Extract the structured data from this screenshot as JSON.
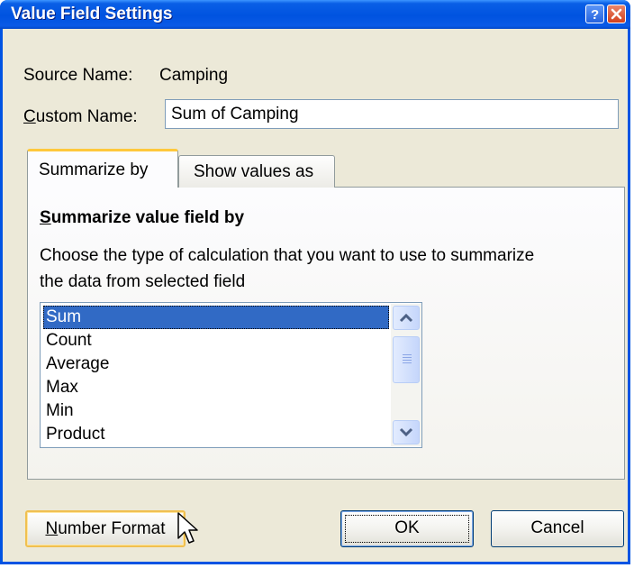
{
  "dialog": {
    "title": "Value Field Settings",
    "source_name_label": "Source Name:",
    "source_name_value": "Camping",
    "custom_name_label": "Custom Name:",
    "custom_name_value": "Sum of Camping"
  },
  "tabs": [
    {
      "label": "Summarize by",
      "active": true
    },
    {
      "label": "Show values as",
      "active": false
    }
  ],
  "panel": {
    "heading": "Summarize value field by",
    "desc_line1": "Choose the type of calculation that you want to use to summarize",
    "desc_line2": "the data from selected field"
  },
  "listbox": {
    "items": [
      "Sum",
      "Count",
      "Average",
      "Max",
      "Min",
      "Product"
    ],
    "selected": "Sum"
  },
  "buttons": {
    "number_format": "Number Format",
    "ok": "OK",
    "cancel": "Cancel"
  },
  "icons": [
    "help-icon",
    "close-icon",
    "scroll-up-arrow-icon",
    "scroll-down-arrow-icon",
    "mouse-pointer-icon"
  ],
  "colors": {
    "title_bar": "#0054e3",
    "dialog_face": "#ece9d8",
    "selection": "#316ac5",
    "close_button": "#d3401d",
    "active_tab_highlight": "#ffc83c"
  }
}
